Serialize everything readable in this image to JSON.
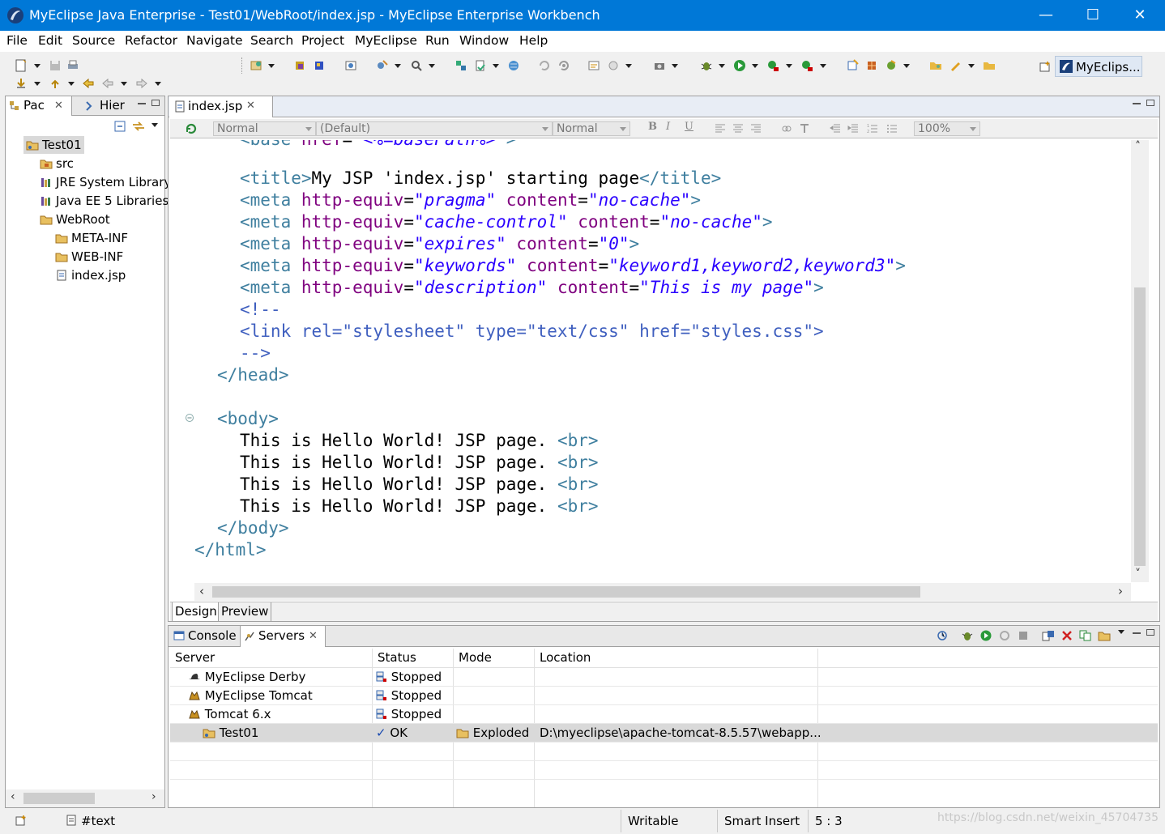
{
  "window": {
    "title": "MyEclipse Java Enterprise - Test01/WebRoot/index.jsp - MyEclipse Enterprise Workbench",
    "controls": {
      "minimize": "—",
      "maximize": "☐",
      "close": "✕"
    }
  },
  "menu": [
    "File",
    "Edit",
    "Source",
    "Refactor",
    "Navigate",
    "Search",
    "Project",
    "MyEclipse",
    "Run",
    "Window",
    "Help"
  ],
  "perspective": {
    "label": "MyEclips..."
  },
  "left_panel": {
    "tabs": [
      "Pac",
      "Hier"
    ],
    "tree": [
      {
        "label": "Test01",
        "icon": "project-icon"
      },
      {
        "label": "src",
        "icon": "package-folder-icon"
      },
      {
        "label": "JRE System Library",
        "icon": "library-icon"
      },
      {
        "label": "Java EE 5 Libraries",
        "icon": "library-icon"
      },
      {
        "label": "WebRoot",
        "icon": "folder-icon"
      },
      {
        "label": "META-INF",
        "icon": "folder-icon"
      },
      {
        "label": "WEB-INF",
        "icon": "folder-icon"
      },
      {
        "label": "index.jsp",
        "icon": "jsp-file-icon"
      }
    ]
  },
  "editor": {
    "tab_label": "index.jsp",
    "format_bar": {
      "style": "Normal",
      "font": "(Default)",
      "size": "Normal",
      "zoom": "100%",
      "bold": "B",
      "italic": "I",
      "underline": "U"
    },
    "bottom_tabs": [
      "Design",
      "Preview"
    ]
  },
  "servers_panel": {
    "tabs": [
      "Console",
      "Servers"
    ],
    "columns": [
      "Server",
      "Status",
      "Mode",
      "Location"
    ],
    "rows": [
      {
        "server": "MyEclipse Derby",
        "status": "Stopped",
        "mode": "",
        "location": ""
      },
      {
        "server": "MyEclipse Tomcat",
        "status": "Stopped",
        "mode": "",
        "location": ""
      },
      {
        "server": "Tomcat  6.x",
        "status": "Stopped",
        "mode": "",
        "location": ""
      },
      {
        "server": "Test01",
        "status": "OK",
        "mode": "Exploded",
        "location": "D:\\myeclipse\\apache-tomcat-8.5.57\\webapp..."
      }
    ]
  },
  "status_bar": {
    "node": "#text",
    "mode": "Writable",
    "insert": "Smart Insert",
    "position": "5 : 3"
  },
  "watermark": "https://blog.csdn.net/weixin_45704735"
}
